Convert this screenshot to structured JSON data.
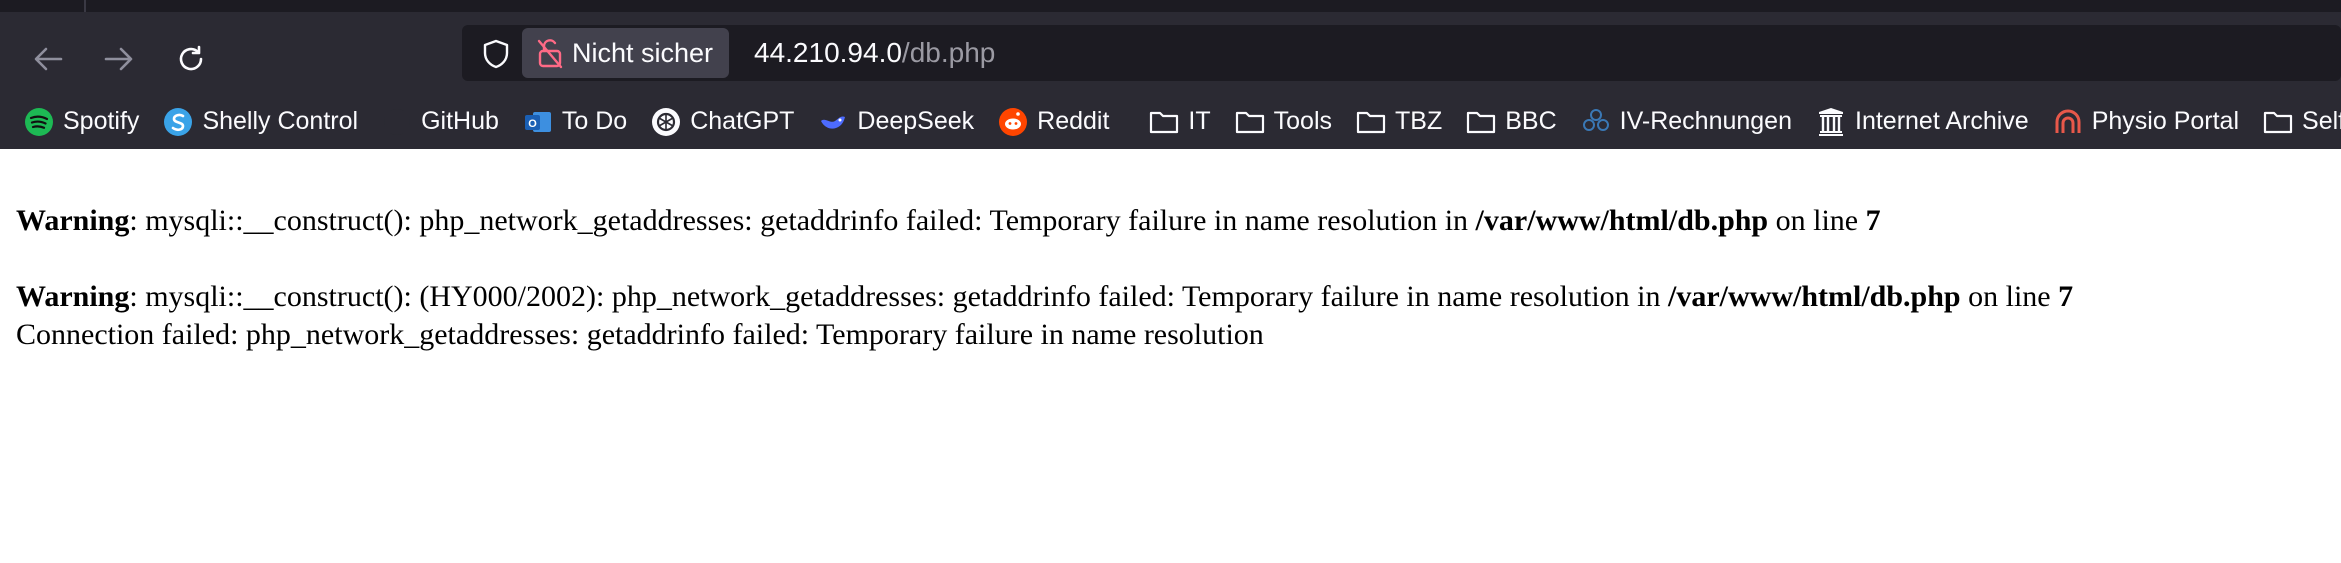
{
  "browser": {
    "security_label": "Nicht sicher",
    "url_host": "44.210.94.0",
    "url_path": "/db.php"
  },
  "bookmarks": [
    {
      "label": "Spotify",
      "icon": "spotify-icon",
      "color": "#1db954"
    },
    {
      "label": "Shelly Control",
      "icon": "shelly-icon",
      "color": "#3aa3e8"
    },
    {
      "label": "GitHub",
      "icon": "github-icon",
      "color": "#ffffff"
    },
    {
      "label": "To Do",
      "icon": "outlook-icon",
      "color": "#2f78c8"
    },
    {
      "label": "ChatGPT",
      "icon": "chatgpt-icon",
      "color": "#ffffff"
    },
    {
      "label": "DeepSeek",
      "icon": "deepseek-icon",
      "color": "#4d6bfe"
    },
    {
      "label": "Reddit",
      "icon": "reddit-icon",
      "color": "#ff4500"
    },
    {
      "label": "IT",
      "icon": "folder-icon"
    },
    {
      "label": "Tools",
      "icon": "folder-icon"
    },
    {
      "label": "TBZ",
      "icon": "folder-icon"
    },
    {
      "label": "BBC",
      "icon": "folder-icon"
    },
    {
      "label": "IV-Rechnungen",
      "icon": "iv-icon",
      "color": "#3a78b5"
    },
    {
      "label": "Internet Archive",
      "icon": "archive-icon",
      "color": "#ffffff"
    },
    {
      "label": "Physio Portal",
      "icon": "physio-icon",
      "color": "#e8584a"
    },
    {
      "label": "Selfmade",
      "icon": "folder-icon"
    }
  ],
  "page": {
    "warning1": {
      "label": "Warning",
      "message": ": mysqli::__construct(): php_network_getaddresses: getaddrinfo failed: Temporary failure in name resolution in ",
      "file": "/var/www/html/db.php",
      "on_line": " on line ",
      "line": "7"
    },
    "warning2": {
      "label": "Warning",
      "message": ": mysqli::__construct(): (HY000/2002): php_network_getaddresses: getaddrinfo failed: Temporary failure in name resolution in ",
      "file": "/var/www/html/db.php",
      "on_line": " on line ",
      "line": "7"
    },
    "connection_error": "Connection failed: php_network_getaddresses: getaddrinfo failed: Temporary failure in name resolution"
  }
}
